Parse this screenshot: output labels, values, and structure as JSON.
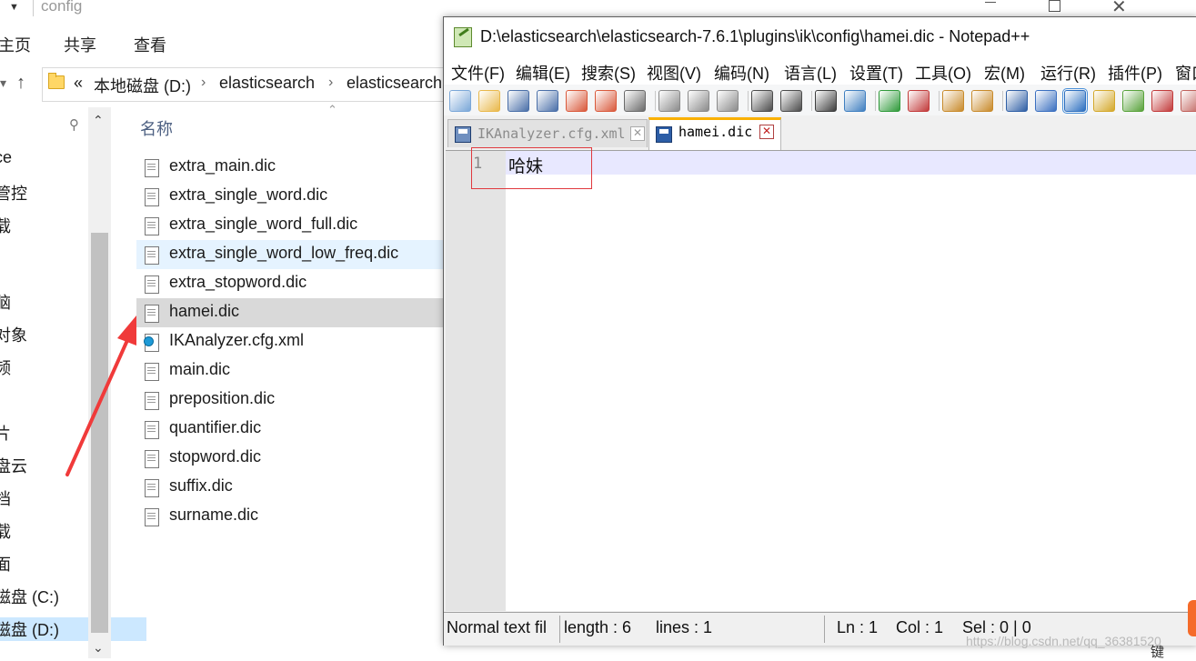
{
  "explorer": {
    "window_title": "config",
    "ribbon_tabs": [
      "主页",
      "共享",
      "查看"
    ],
    "address_path": [
      "本地磁盘 (D:)",
      "elasticsearch",
      "elasticsearch"
    ],
    "address_overflow": "«",
    "column_header": "名称",
    "nav_items": [
      "",
      "ce",
      "管控",
      "载",
      "",
      "脑",
      "对象",
      "频",
      "",
      "片",
      "盘云",
      "档",
      "载",
      "面",
      "磁盘 (C:)",
      "磁盘 (D:)"
    ],
    "files": [
      {
        "name": "extra_main.dic",
        "type": "dic"
      },
      {
        "name": "extra_single_word.dic",
        "type": "dic"
      },
      {
        "name": "extra_single_word_full.dic",
        "type": "dic"
      },
      {
        "name": "extra_single_word_low_freq.dic",
        "type": "dic"
      },
      {
        "name": "extra_stopword.dic",
        "type": "dic"
      },
      {
        "name": "hamei.dic",
        "type": "dic"
      },
      {
        "name": "IKAnalyzer.cfg.xml",
        "type": "xml"
      },
      {
        "name": "main.dic",
        "type": "dic"
      },
      {
        "name": "preposition.dic",
        "type": "dic"
      },
      {
        "name": "quantifier.dic",
        "type": "dic"
      },
      {
        "name": "stopword.dic",
        "type": "dic"
      },
      {
        "name": "suffix.dic",
        "type": "dic"
      },
      {
        "name": "surname.dic",
        "type": "dic"
      }
    ],
    "hovered_file": "extra_single_word_low_freq.dic",
    "selected_file": "hamei.dic",
    "annotation_arrow_color": "#f03a3a"
  },
  "notepad": {
    "title": "D:\\elasticsearch\\elasticsearch-7.6.1\\plugins\\ik\\config\\hamei.dic - Notepad++",
    "menu": [
      "文件(F)",
      "编辑(E)",
      "搜索(S)",
      "视图(V)",
      "编码(N)",
      "语言(L)",
      "设置(T)",
      "工具(O)",
      "宏(M)",
      "运行(R)",
      "插件(P)",
      "窗口"
    ],
    "tabs": [
      {
        "label": "IKAnalyzer.cfg.xml",
        "active": false
      },
      {
        "label": "hamei.dic",
        "active": true
      }
    ],
    "tab_close_glyph": "✕",
    "lines": [
      {
        "number": "1",
        "text": "哈妹"
      }
    ],
    "status": {
      "type": "Normal text fil",
      "length": "length : 6",
      "lines": "lines : 1",
      "ln": "Ln : 1",
      "col": "Col : 1",
      "sel": "Sel : 0 | 0"
    },
    "annotation_box_color": "#e0393e"
  },
  "watermark": "https://blog.csdn.net/qq_36381520",
  "corner_text": "键"
}
